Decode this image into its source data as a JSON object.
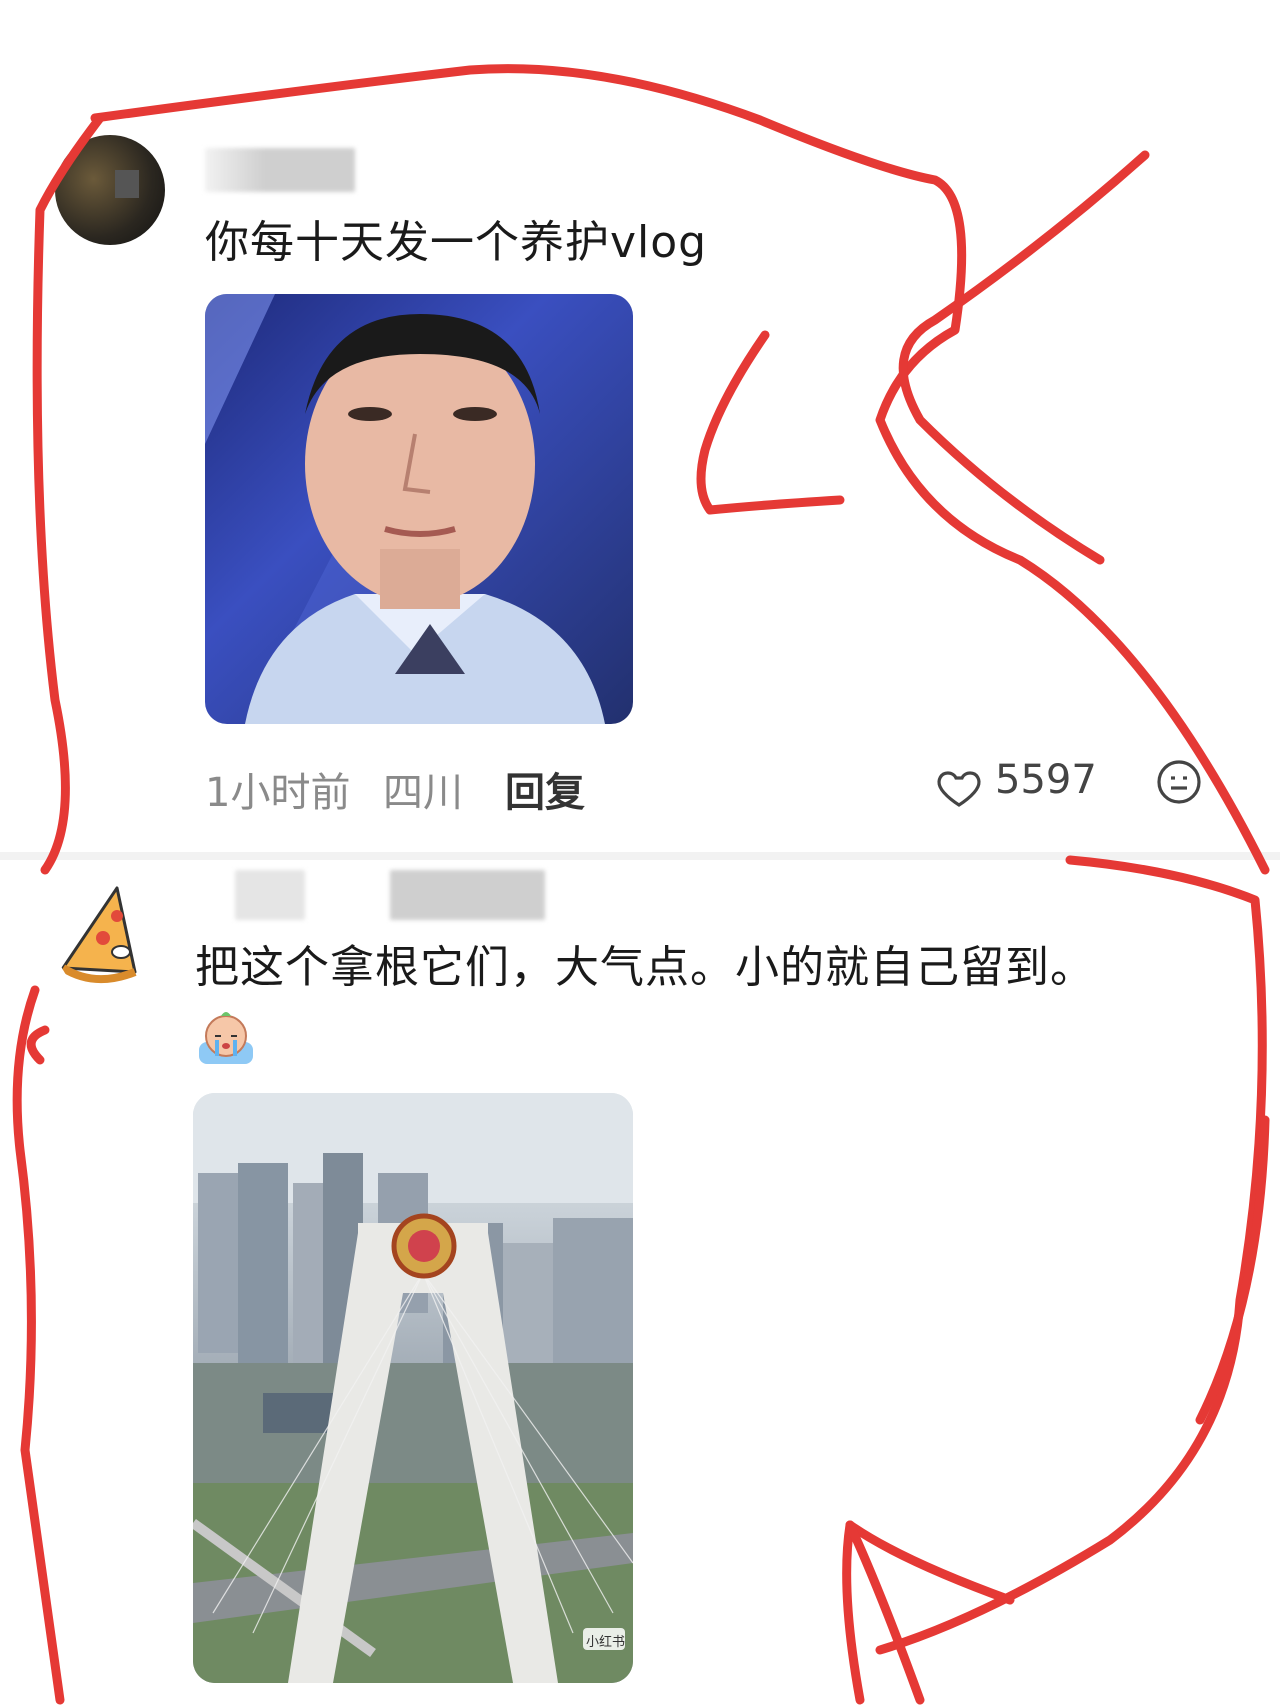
{
  "comments": [
    {
      "text": "你每十天发一个养护vlog",
      "time": "1小时前",
      "location": "四川",
      "reply_label": "回复",
      "likes": "5597",
      "image": "meme-man-face"
    },
    {
      "text": "把这个拿根它们，大气点。小的就自己留到。",
      "emoji": "crying-emoji",
      "image": "bridge-city-photo",
      "watermark": "小红书"
    }
  ],
  "icons": [
    "heart-icon",
    "neutral-face-icon"
  ],
  "colors": {
    "annotation": "#e53935",
    "meta": "#8a8a8a"
  }
}
